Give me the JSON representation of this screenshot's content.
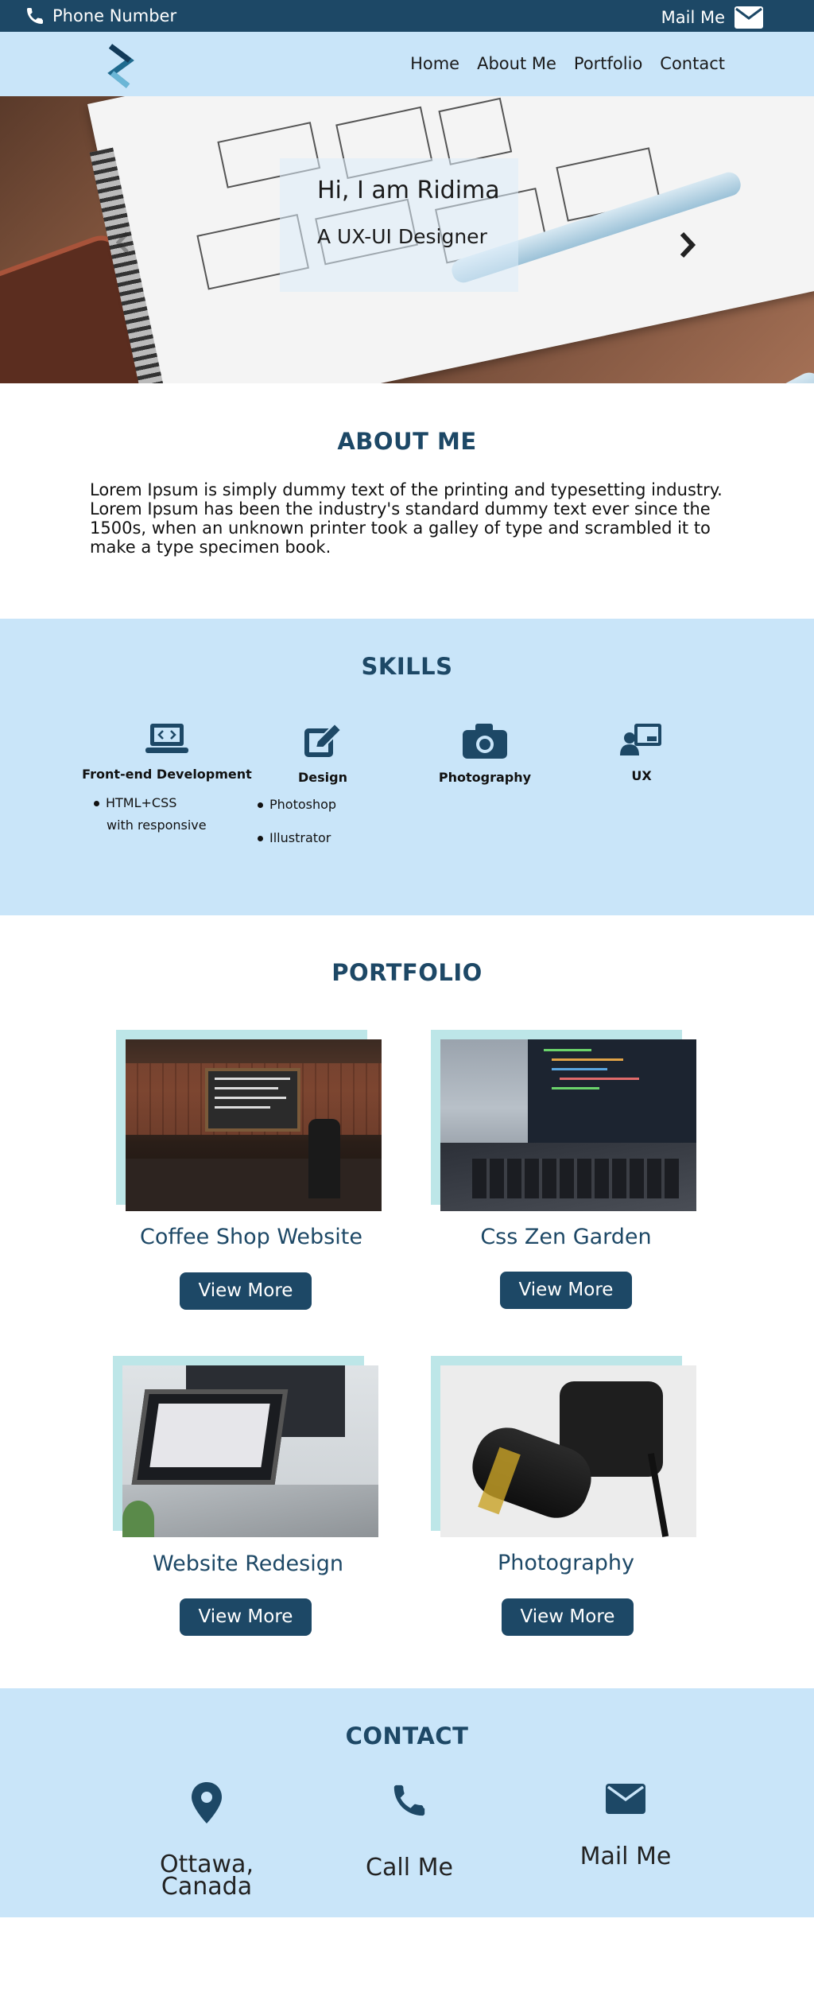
{
  "topbar": {
    "phone_label": "Phone Number",
    "mail_label": "Mail Me"
  },
  "nav": {
    "items": [
      "Home",
      "About Me",
      "Portfolio",
      "Contact"
    ]
  },
  "hero": {
    "title": "Hi, I am Ridima",
    "subtitle": "A UX-UI Designer"
  },
  "about": {
    "title": "ABOUT ME",
    "text": "Lorem Ipsum is simply dummy text of the printing and typesetting industry. Lorem Ipsum has been the industry's standard dummy text ever since the 1500s, when an unknown printer took a galley of type and scrambled it to make a type specimen book."
  },
  "skills": {
    "title": "SKILLS",
    "items": [
      {
        "label": "Front-end Development",
        "icon": "laptop-code-icon"
      },
      {
        "label": "Design",
        "icon": "edit-icon"
      },
      {
        "label": "Photography",
        "icon": "camera-icon"
      },
      {
        "label": "UX",
        "icon": "user-board-icon"
      }
    ],
    "frontend_list": [
      "HTML+CSS",
      "with responsive"
    ],
    "design_list": [
      "Photoshop",
      "Illustrator"
    ]
  },
  "portfolio": {
    "title": "PORTFOLIO",
    "items": [
      {
        "title": "Coffee Shop Website",
        "button": "View More"
      },
      {
        "title": "Css Zen Garden",
        "button": "View More"
      },
      {
        "title": "Website Redesign",
        "button": "View More"
      },
      {
        "title": "Photography",
        "button": "View More"
      }
    ]
  },
  "contact": {
    "title": "CONTACT",
    "items": [
      {
        "label": "Ottawa, Canada",
        "icon": "map-marker-icon"
      },
      {
        "label": "Call Me",
        "icon": "phone-icon"
      },
      {
        "label": "Mail Me",
        "icon": "envelope-icon"
      }
    ]
  },
  "colors": {
    "navy": "#1d4866",
    "light_blue": "#c9e5f9",
    "teal_backdrop": "#bde6e8"
  }
}
